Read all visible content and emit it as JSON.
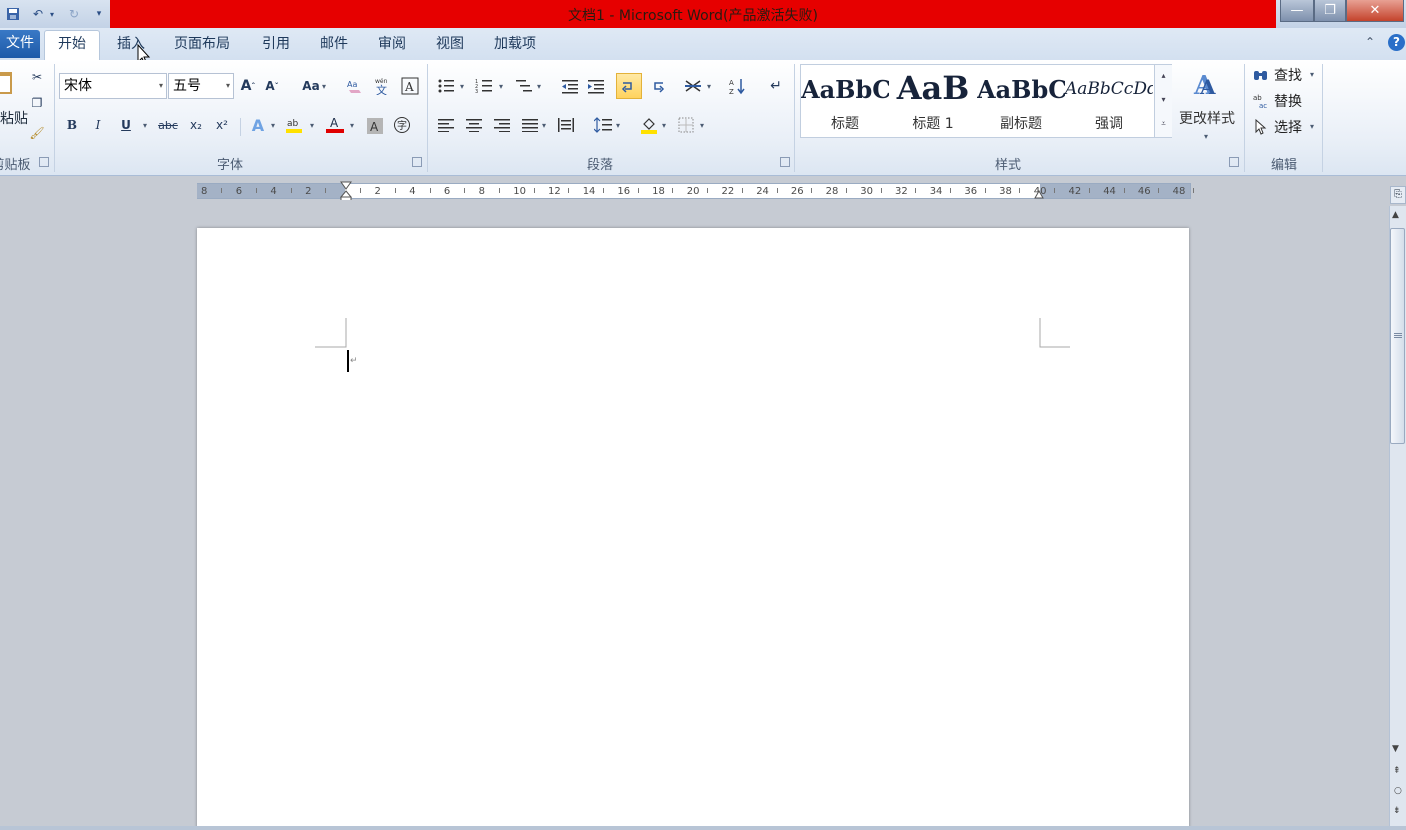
{
  "window": {
    "title": "文档1 - Microsoft Word(产品激活失败)",
    "min_glyph": "—",
    "max_glyph": "❐",
    "close_glyph": "✕"
  },
  "tabs": [
    {
      "label": "文件"
    },
    {
      "label": "开始"
    },
    {
      "label": "插入"
    },
    {
      "label": "页面布局"
    },
    {
      "label": "引用"
    },
    {
      "label": "邮件"
    },
    {
      "label": "审阅"
    },
    {
      "label": "视图"
    },
    {
      "label": "加载项"
    }
  ],
  "ribbon": {
    "clipboard": {
      "label": "剪贴板",
      "paste": "粘贴"
    },
    "font": {
      "label": "字体",
      "font_name": "宋体",
      "font_size": "五号",
      "case_btn": "Aa",
      "bold": "B",
      "italic": "I",
      "underline": "U",
      "strike": "abc",
      "subscript": "x₂",
      "superscript": "x²",
      "color_letter": "A"
    },
    "paragraph": {
      "label": "段落"
    },
    "styles": {
      "label": "样式",
      "items": [
        {
          "sample": "AaBbC",
          "name": "标题"
        },
        {
          "sample": "AaB",
          "name": "标题 1"
        },
        {
          "sample": "AaBbC",
          "name": "副标题"
        },
        {
          "sample": "AaBbCcDd",
          "name": "强调"
        }
      ],
      "change_styles": "更改样式"
    },
    "editing": {
      "label": "编辑",
      "find": "查找",
      "replace": "替换",
      "select": "选择"
    }
  },
  "ruler": {
    "ticks": [
      "8",
      "6",
      "4",
      "2",
      "",
      "2",
      "4",
      "6",
      "8",
      "10",
      "12",
      "14",
      "16",
      "18",
      "20",
      "22",
      "24",
      "26",
      "28",
      "30",
      "32",
      "34",
      "36",
      "38",
      "40",
      "42",
      "44",
      "46",
      "48"
    ]
  },
  "colors": {
    "title_red": "#e60000",
    "accent_blue": "#2a6fc8",
    "font_color_bar": "#e00000",
    "highlight_bar": "#ffe100"
  }
}
